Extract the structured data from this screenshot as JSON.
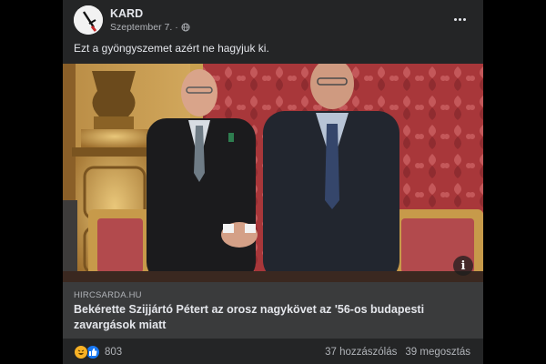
{
  "post": {
    "page_name": "KARD",
    "date": "Szeptember 7.",
    "separator": "·",
    "text": "Ezt a gyöngyszemet azért ne hagyjuk ki."
  },
  "link": {
    "domain": "HIRCSARDA.HU",
    "title": "Bekérette Szijjártó Pétert az orosz nagykövet az '56-os budapesti zavargások miatt"
  },
  "engagement": {
    "reaction_count": "803",
    "comments": "37 hozzászólás",
    "shares": "39 megosztás"
  },
  "icons": {
    "avatar": "sword-icon",
    "privacy": "globe-icon",
    "more": "more-options-icon",
    "info": "info-icon",
    "reactions": [
      "haha-reaction-icon",
      "like-reaction-icon"
    ]
  },
  "colors": {
    "card_bg": "#242526",
    "link_bg": "#3a3b3c",
    "text_primary": "#e4e6eb",
    "text_secondary": "#b0b3b8",
    "like_blue": "#1877f2",
    "haha_yellow": "#f7b125"
  }
}
